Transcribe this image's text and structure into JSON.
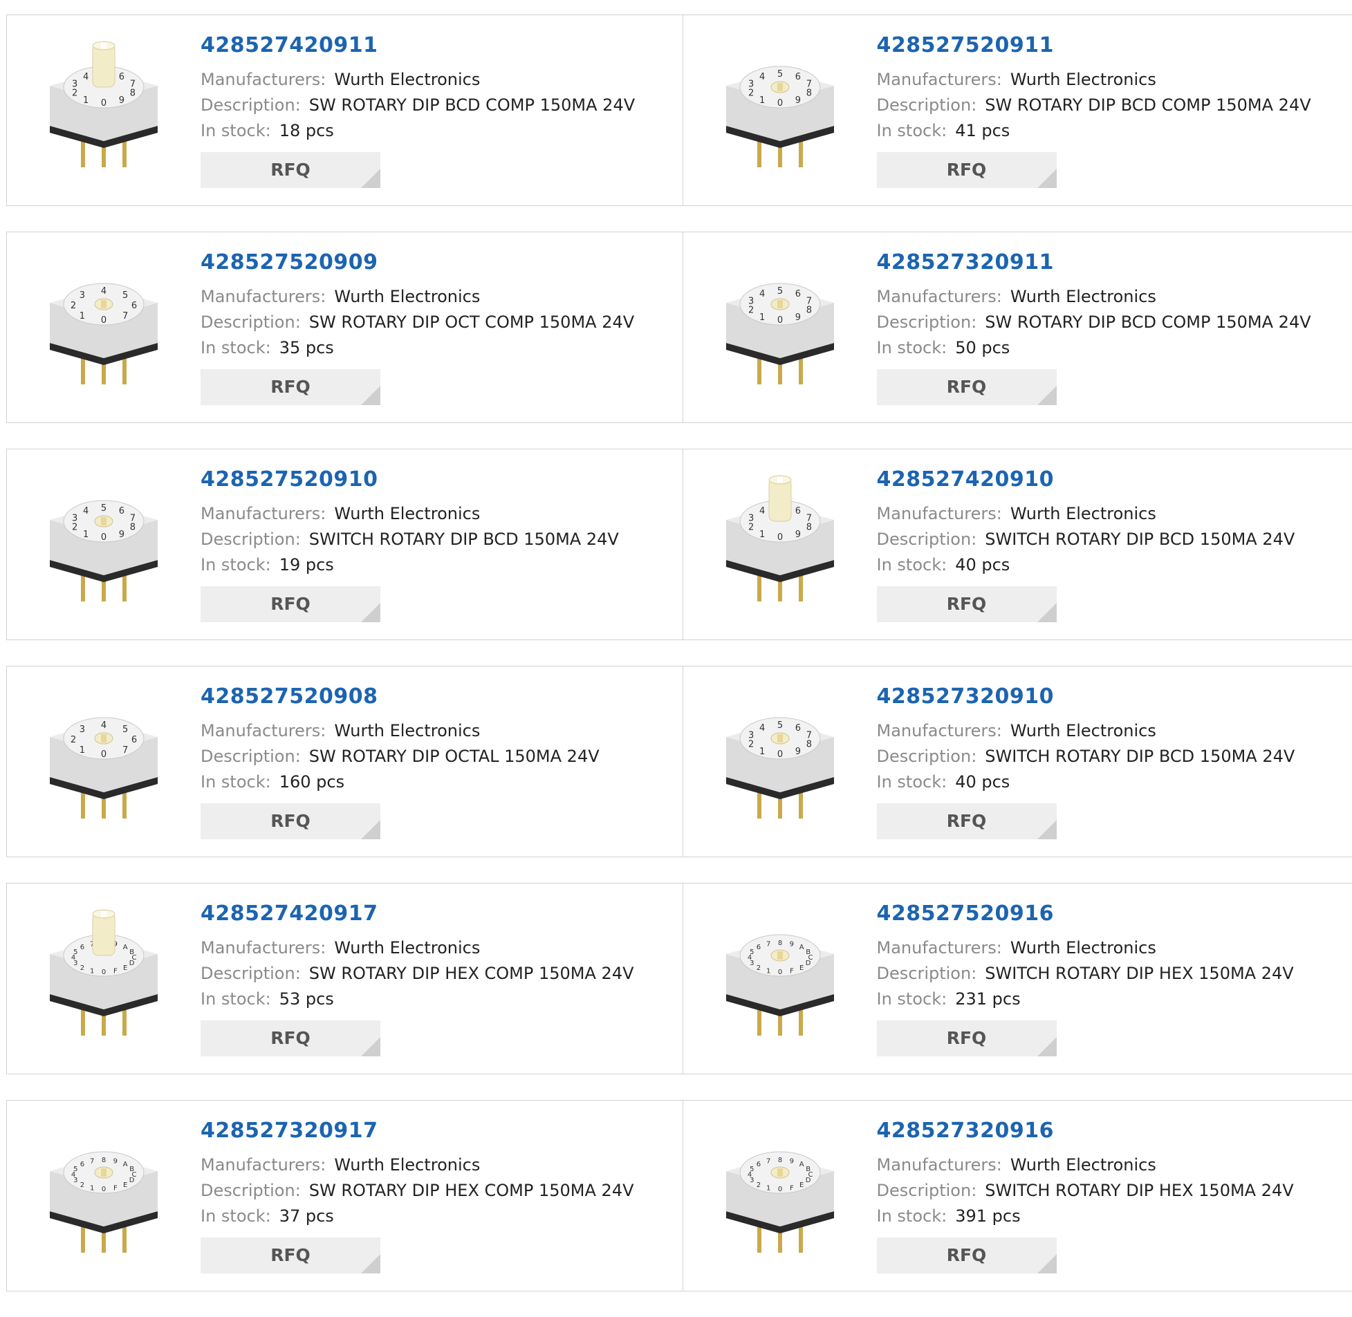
{
  "labels": {
    "manufacturer": "Manufacturers:",
    "description": "Description:",
    "stock": "In stock:",
    "rfq": "RFQ"
  },
  "products": [
    {
      "part": "428527420911",
      "manufacturer": "Wurth Electronics",
      "description": "SW ROTARY DIP BCD COMP 150MA 24V",
      "stock": "18 pcs",
      "style": "shaft",
      "digits": "0123456789"
    },
    {
      "part": "428527520911",
      "manufacturer": "Wurth Electronics",
      "description": "SW ROTARY DIP BCD COMP 150MA 24V",
      "stock": "41 pcs",
      "style": "flat",
      "digits": "0123456789"
    },
    {
      "part": "428527520909",
      "manufacturer": "Wurth Electronics",
      "description": "SW ROTARY DIP OCT COMP 150MA 24V",
      "stock": "35 pcs",
      "style": "flat",
      "digits": "01234567"
    },
    {
      "part": "428527320911",
      "manufacturer": "Wurth Electronics",
      "description": "SW ROTARY DIP BCD COMP 150MA 24V",
      "stock": "50 pcs",
      "style": "flat",
      "digits": "0123456789"
    },
    {
      "part": "428527520910",
      "manufacturer": "Wurth Electronics",
      "description": "SWITCH ROTARY DIP BCD 150MA 24V",
      "stock": "19 pcs",
      "style": "flat",
      "digits": "0123456789"
    },
    {
      "part": "428527420910",
      "manufacturer": "Wurth Electronics",
      "description": "SWITCH ROTARY DIP BCD 150MA 24V",
      "stock": "40 pcs",
      "style": "shaft",
      "digits": "0123456789"
    },
    {
      "part": "428527520908",
      "manufacturer": "Wurth Electronics",
      "description": "SW ROTARY DIP OCTAL 150MA 24V",
      "stock": "160 pcs",
      "style": "flat",
      "digits": "01234567"
    },
    {
      "part": "428527320910",
      "manufacturer": "Wurth Electronics",
      "description": "SWITCH ROTARY DIP BCD 150MA 24V",
      "stock": "40 pcs",
      "style": "flat",
      "digits": "0123456789"
    },
    {
      "part": "428527420917",
      "manufacturer": "Wurth Electronics",
      "description": "SW ROTARY DIP HEX COMP 150MA 24V",
      "stock": "53 pcs",
      "style": "shaft",
      "digits": "0123456789ABCDEF"
    },
    {
      "part": "428527520916",
      "manufacturer": "Wurth Electronics",
      "description": "SWITCH ROTARY DIP HEX 150MA 24V",
      "stock": "231 pcs",
      "style": "flat",
      "digits": "0123456789ABCDEF"
    },
    {
      "part": "428527320917",
      "manufacturer": "Wurth Electronics",
      "description": "SW ROTARY DIP HEX COMP 150MA 24V",
      "stock": "37 pcs",
      "style": "flat",
      "digits": "0123456789ABCDEF"
    },
    {
      "part": "428527320916",
      "manufacturer": "Wurth Electronics",
      "description": "SWITCH ROTARY DIP HEX 150MA 24V",
      "stock": "391 pcs",
      "style": "flat",
      "digits": "0123456789ABCDEF"
    }
  ]
}
